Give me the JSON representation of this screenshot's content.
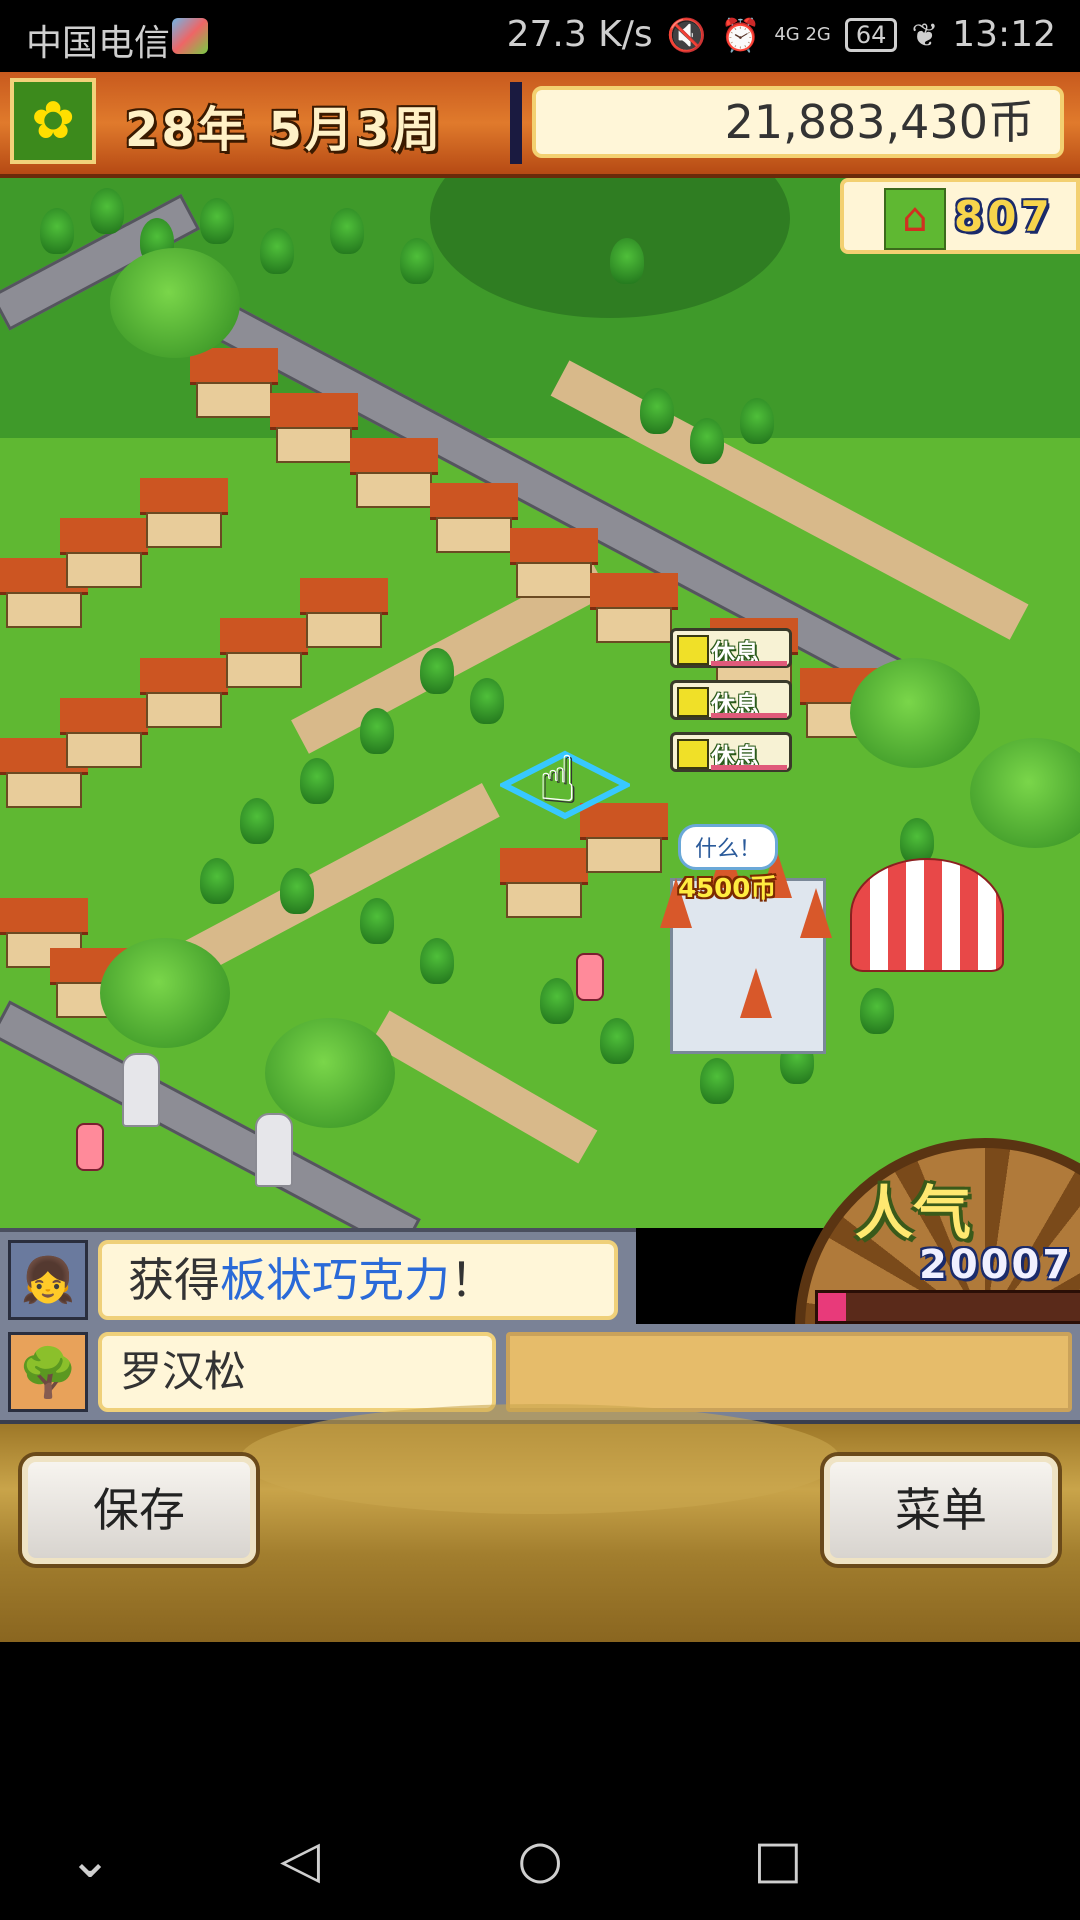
{
  "status_bar": {
    "carrier": "中国电信",
    "net_speed": "27.3 K/s",
    "network": "4G 2G",
    "battery": "64",
    "time": "13:12"
  },
  "hud": {
    "year_month_week": "28年 5月3周",
    "money": "21,883,430币",
    "population": "807"
  },
  "map": {
    "rest_tags": [
      "休息",
      "休息",
      "休息"
    ],
    "speech": "什么！",
    "earning": "4500币"
  },
  "popularity": {
    "title": "人气",
    "value": "20007",
    "level": 0.1
  },
  "message": {
    "prefix": "获得",
    "item": "板状巧克力",
    "suffix": "！"
  },
  "selection": {
    "name": "罗汉松",
    "detail": ""
  },
  "buttons": {
    "save": "保存",
    "menu": "菜单"
  },
  "nav": {
    "icons": [
      "chevron-down-icon",
      "back-icon",
      "home-icon",
      "recents-icon"
    ]
  }
}
